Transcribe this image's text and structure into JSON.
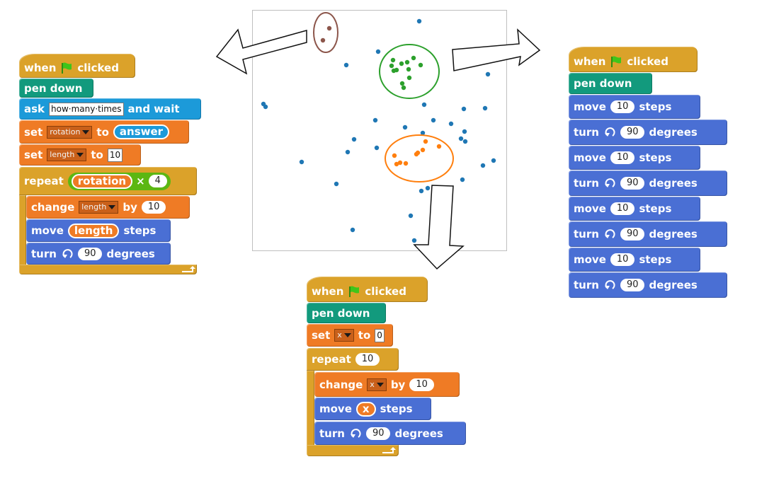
{
  "colors": {
    "events": "#dba22a",
    "pen": "#129a7d",
    "sensing": "#1c9ad9",
    "variables": "#ef7b25",
    "motion": "#4a6fd4",
    "operators": "#5cb712",
    "dots": "#1f77b4",
    "cluster_green": "#2ca02c",
    "cluster_orange": "#ff7f0e",
    "cluster_brown": "#8c564b"
  },
  "left_program": {
    "hat": {
      "when": "when",
      "clicked": "clicked"
    },
    "pen_down": "pen down",
    "ask": {
      "label": "ask",
      "prompt": "how·many·times",
      "suffix": "and wait"
    },
    "set1": {
      "label": "set",
      "var": "rotation",
      "to": "to",
      "value": "answer"
    },
    "set2": {
      "label": "set",
      "var": "length",
      "to": "to",
      "value": "10"
    },
    "repeat": {
      "label": "repeat",
      "var": "rotation",
      "op": "×",
      "num": "4"
    },
    "change": {
      "label": "change",
      "var": "length",
      "by": "by",
      "value": "10"
    },
    "move": {
      "label": "move",
      "var": "length",
      "suffix": "steps"
    },
    "turn": {
      "label": "turn",
      "value": "90",
      "suffix": "degrees"
    }
  },
  "right_program": {
    "hat": {
      "when": "when",
      "clicked": "clicked"
    },
    "pen_down": "pen down",
    "move": {
      "label": "move",
      "value": "10",
      "suffix": "steps"
    },
    "turn": {
      "label": "turn",
      "value": "90",
      "suffix": "degrees"
    }
  },
  "bottom_program": {
    "hat": {
      "when": "when",
      "clicked": "clicked"
    },
    "pen_down": "pen down",
    "set": {
      "label": "set",
      "var": "x",
      "to": "to",
      "value": "0"
    },
    "repeat": {
      "label": "repeat",
      "value": "10"
    },
    "change": {
      "label": "change",
      "var": "x",
      "by": "by",
      "value": "10"
    },
    "move": {
      "label": "move",
      "var": "x",
      "suffix": "steps"
    },
    "turn": {
      "label": "turn",
      "value": "90",
      "suffix": "degrees"
    }
  }
}
